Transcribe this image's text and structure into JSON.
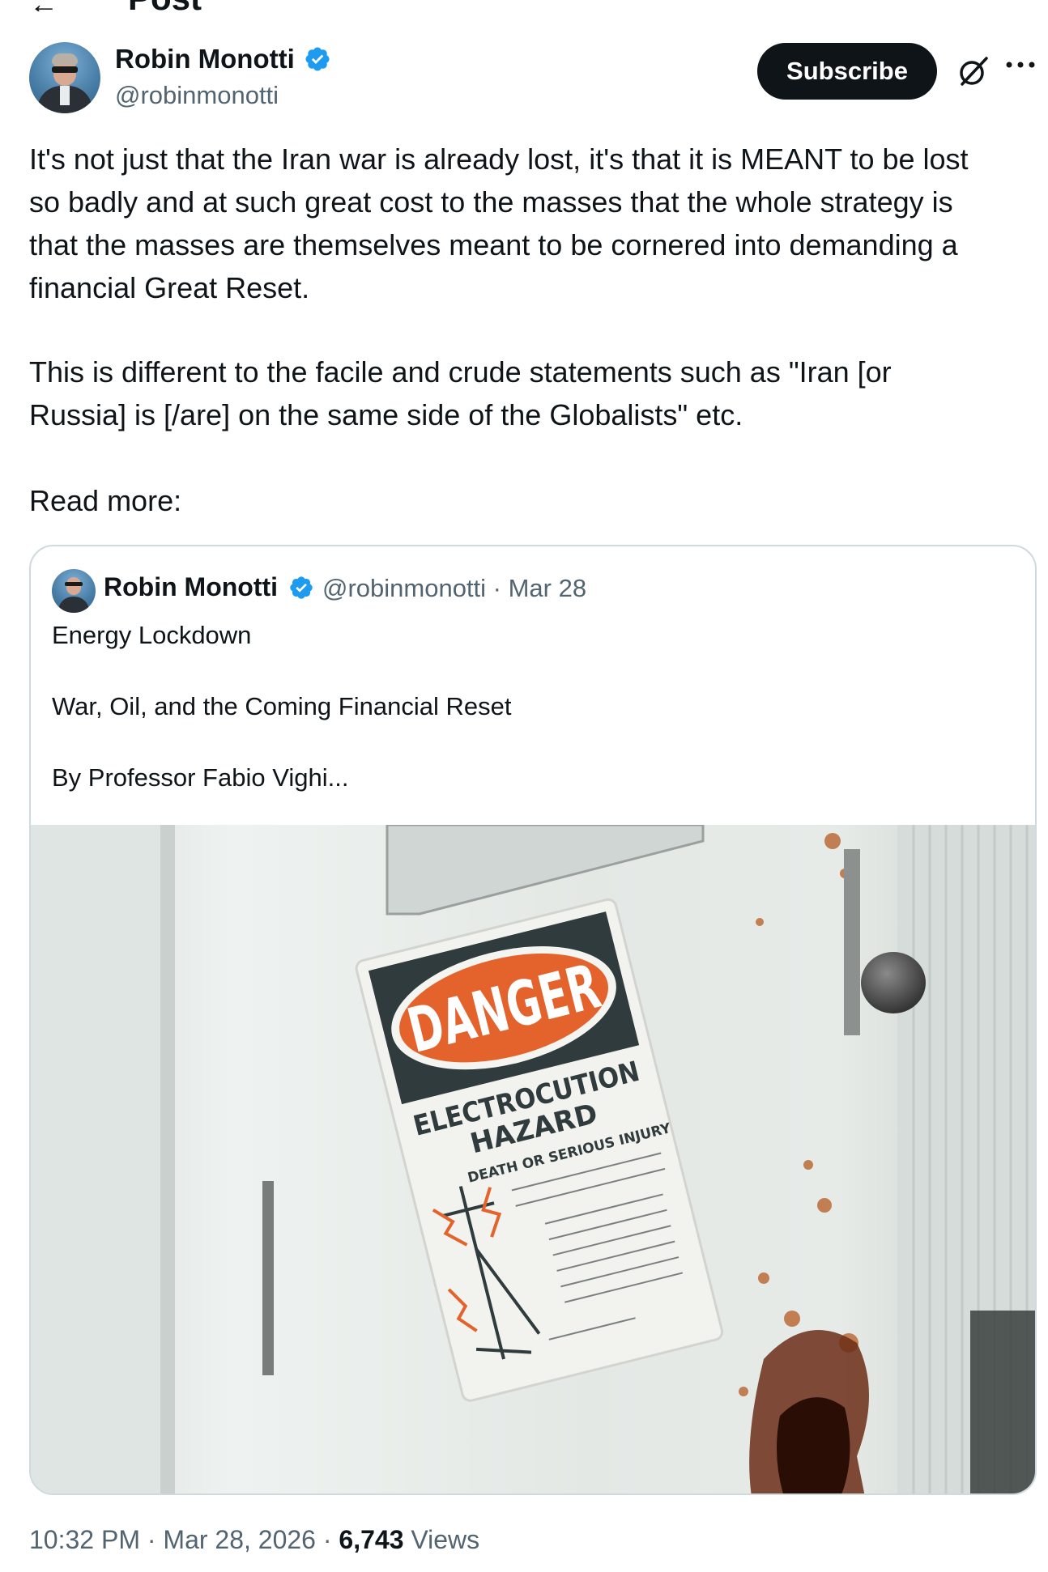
{
  "header": {
    "back_icon": "arrow-left-icon",
    "title": "Post"
  },
  "author": {
    "name": "Robin Monotti",
    "handle": "@robinmonotti",
    "verified": true,
    "verified_color": "#1d9bf0"
  },
  "actions": {
    "subscribe_label": "Subscribe",
    "grok_icon": "grok-icon",
    "more_icon": "more-icon"
  },
  "post": {
    "paragraph_1_lines": [
      "It's not just that the Iran war is already lost, it's that it is MEANT to be lost",
      "so badly and at such great cost to the masses that the whole strategy is",
      "that the masses are themselves meant to be cornered into demanding a",
      "financial Great Reset."
    ],
    "paragraph_2_lines": [
      "This is different to the facile and crude statements such as \"Iran [or",
      "Russia] is [/are] on the same side of the Globalists\" etc."
    ],
    "paragraph_3": "Read more:"
  },
  "quote": {
    "name": "Robin Monotti",
    "meta": "@robinmonotti · Mar 28",
    "lines": [
      "Energy Lockdown",
      "",
      "War, Oil, and the Coming Financial Reset",
      "",
      "By Professor Fabio Vighi..."
    ],
    "image": {
      "sign_header": "DANGER",
      "sign_line_1": "ELECTROCUTION",
      "sign_line_2": "HAZARD",
      "sign_line_3": "DEATH OR SERIOUS INJURY"
    }
  },
  "footer": {
    "time": "10:32 PM",
    "sep": "·",
    "date": "Mar 28, 2026",
    "views_count": "6,743",
    "views_label": "Views"
  }
}
